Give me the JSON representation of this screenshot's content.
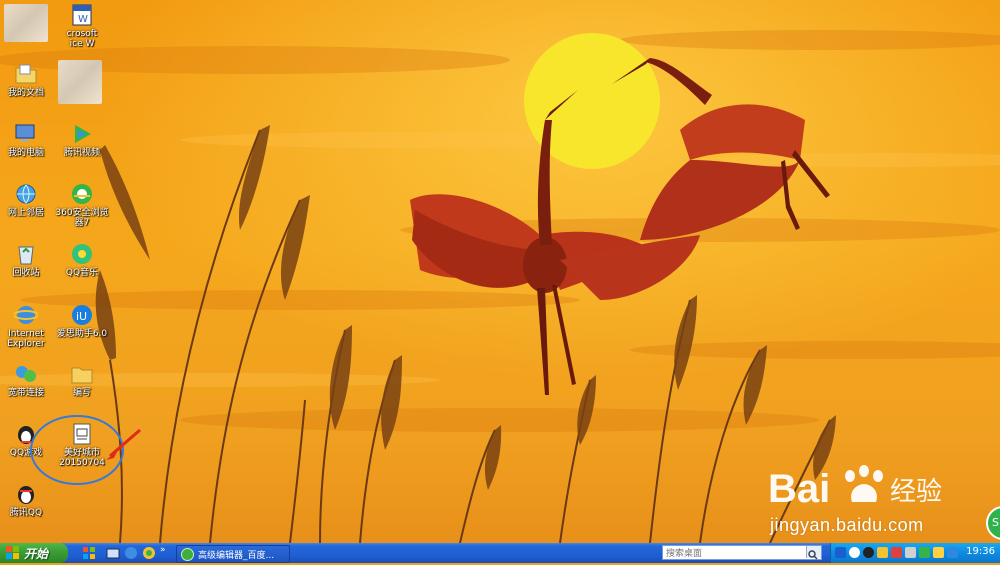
{
  "desktop": {
    "icons_col1": [
      {
        "name": "my-documents",
        "label": "我的文档"
      },
      {
        "name": "my-computer",
        "label": "我的电脑"
      },
      {
        "name": "network-places",
        "label": "网上邻居"
      },
      {
        "name": "recycle-bin",
        "label": "回收站"
      },
      {
        "name": "internet-explorer",
        "label": "Internet\nExplorer"
      },
      {
        "name": "broadband",
        "label": "宽带连接"
      },
      {
        "name": "qq-game",
        "label": "QQ游戏"
      },
      {
        "name": "tencent-qq",
        "label": "腾讯QQ"
      }
    ],
    "icons_col2": [
      {
        "name": "word-doc",
        "label": "crosoft\nice W"
      },
      {
        "name": "tencent-video",
        "label": "腾讯视频"
      },
      {
        "name": "360-browser",
        "label": "360安全浏览\n器7"
      },
      {
        "name": "qq-music",
        "label": "QQ音乐"
      },
      {
        "name": "aisi-helper",
        "label": "爱思助手6.0"
      },
      {
        "name": "edit-folder",
        "label": "编写"
      },
      {
        "name": "city-file",
        "label": "美好城市\n20150704"
      }
    ]
  },
  "taskbar": {
    "start_label": "开始",
    "task_button_label": "高级编辑器_百度...",
    "search_placeholder": "搜索桌面",
    "clock": "19:36"
  },
  "watermark": {
    "logo_text": "Bai经验",
    "url": "jingyan.baidu.com"
  },
  "colors": {
    "sky": "#f39a18",
    "sun": "#f5e32a",
    "taskbar": "#2466d8",
    "start": "#3a9d35",
    "annotation": "#3a78d6"
  }
}
